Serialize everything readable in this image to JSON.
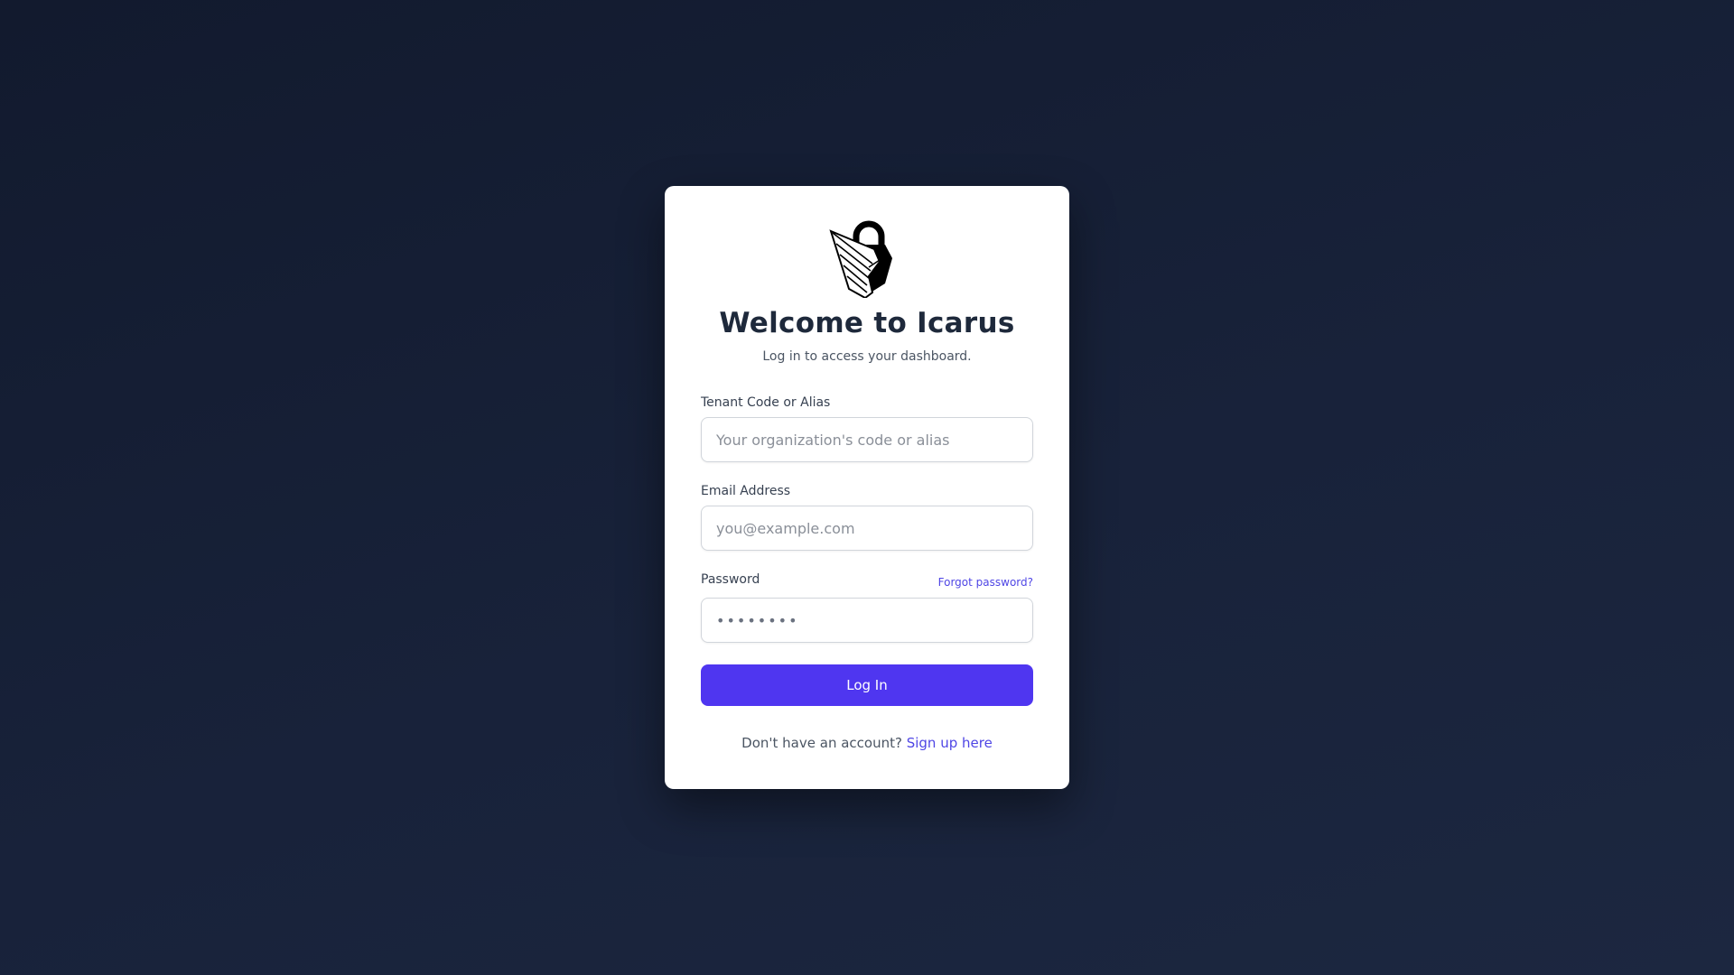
{
  "header": {
    "title": "Welcome to Icarus",
    "subtitle": "Log in to access your dashboard.",
    "logo_icon": "winged-padlock-icon"
  },
  "form": {
    "tenant": {
      "label": "Tenant Code or Alias",
      "value": "",
      "placeholder": "Your organization's code or alias"
    },
    "email": {
      "label": "Email Address",
      "value": "",
      "placeholder": "you@example.com"
    },
    "password": {
      "label": "Password",
      "value": "",
      "placeholder": "••••••••",
      "forgot_label": "Forgot password?"
    },
    "submit_label": "Log In"
  },
  "footer": {
    "prompt": "Don't have an account?",
    "signup_label": "Sign up here"
  },
  "colors": {
    "accent": "#4f36f0",
    "link": "#4f46e5",
    "background": "#141c30",
    "card": "#ffffff",
    "title": "#1e293b"
  }
}
